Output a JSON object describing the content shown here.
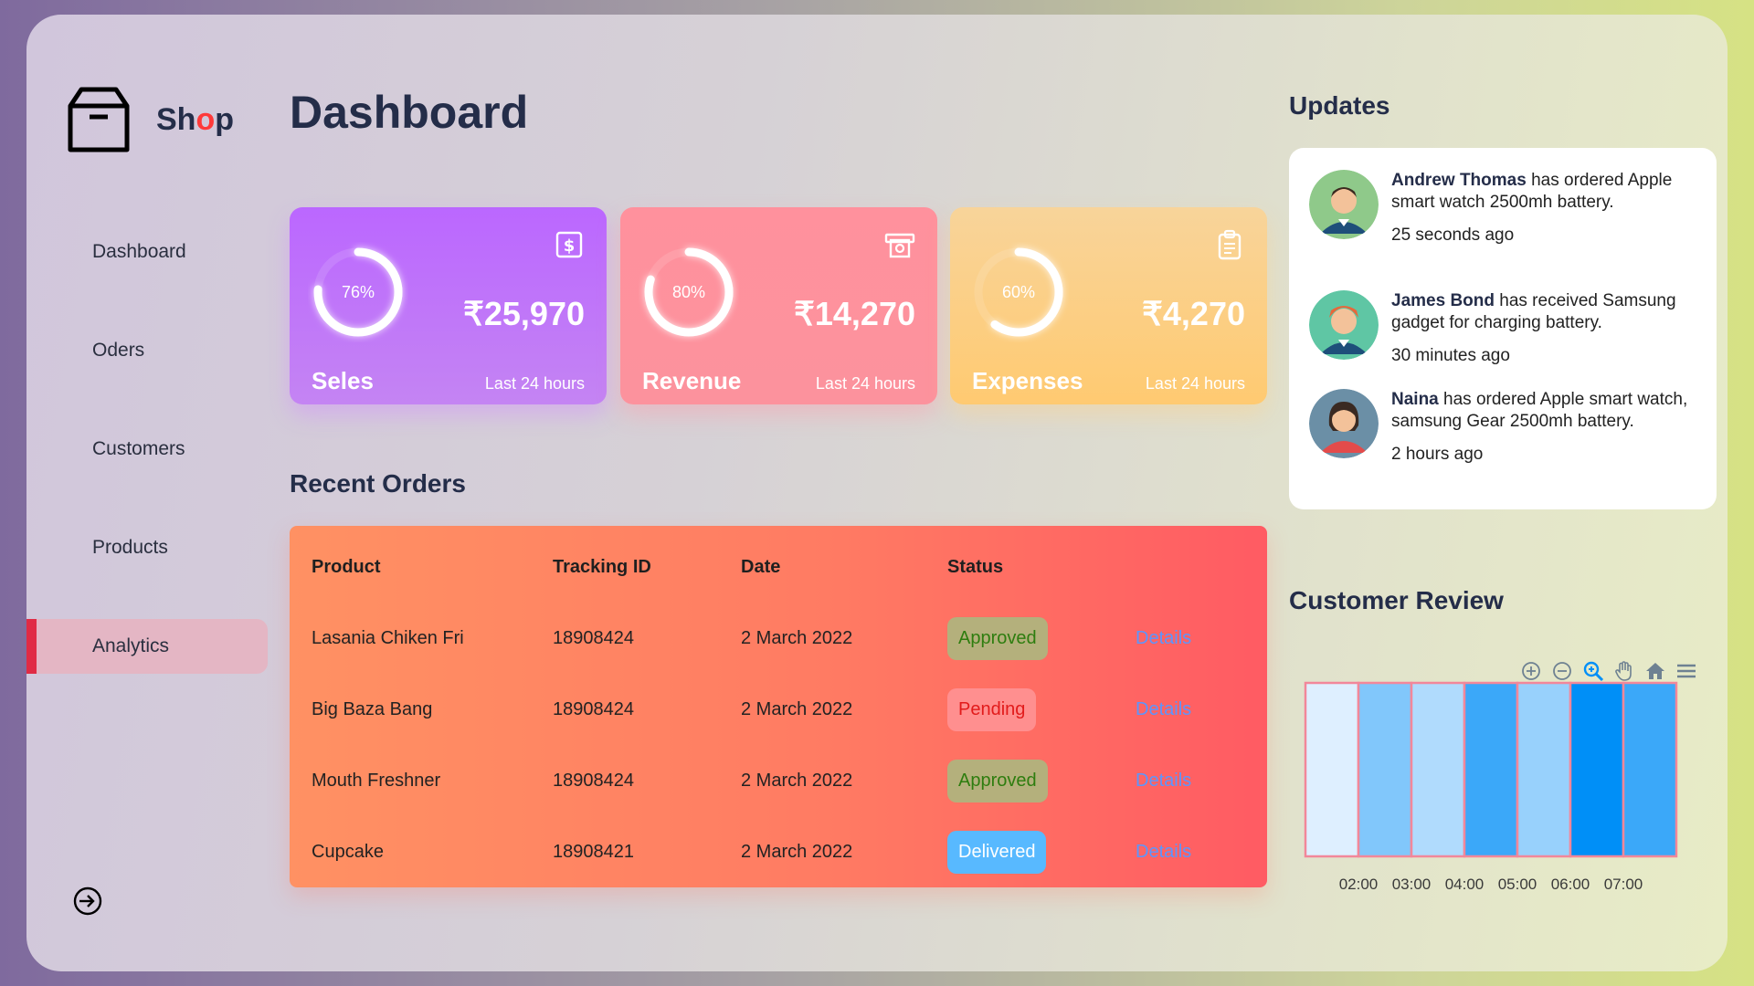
{
  "brand": {
    "prefix": "Sh",
    "accent": "o",
    "suffix": "p",
    "accent_color": "#ff3a3a"
  },
  "sidebar": {
    "items": [
      {
        "label": "Dashboard"
      },
      {
        "label": "Oders"
      },
      {
        "label": "Customers"
      },
      {
        "label": "Products"
      },
      {
        "label": "Analytics",
        "active": true
      }
    ],
    "signout_icon": "sign-out-icon"
  },
  "main": {
    "title": "Dashboard",
    "cards": [
      {
        "label": "Seles",
        "value": "₹25,970",
        "percent": "76%",
        "percent_value": 0.76,
        "sub": "Last 24 hours",
        "icon": "dollar-icon"
      },
      {
        "label": "Revenue",
        "value": "₹14,270",
        "percent": "80%",
        "percent_value": 0.8,
        "sub": "Last 24 hours",
        "icon": "money-icon"
      },
      {
        "label": "Expenses",
        "value": "₹4,270",
        "percent": "60%",
        "percent_value": 0.6,
        "sub": "Last 24 hours",
        "icon": "clipboard-icon"
      }
    ],
    "recent_orders": {
      "title": "Recent Orders",
      "columns": [
        "Product",
        "Tracking ID",
        "Date",
        "Status"
      ],
      "rows": [
        {
          "product": "Lasania Chiken Fri",
          "tracking": "18908424",
          "date": "2 March 2022",
          "status": "Approved",
          "action": "Details"
        },
        {
          "product": "Big Baza Bang",
          "tracking": "18908424",
          "date": "2 March 2022",
          "status": "Pending",
          "action": "Details"
        },
        {
          "product": "Mouth Freshner",
          "tracking": "18908424",
          "date": "2 March 2022",
          "status": "Approved",
          "action": "Details"
        },
        {
          "product": "Cupcake",
          "tracking": "18908421",
          "date": "2 March 2022",
          "status": "Delivered",
          "action": "Details"
        }
      ]
    }
  },
  "updates": {
    "title": "Updates",
    "items": [
      {
        "name": "Andrew Thomas",
        "text": " has ordered Apple smart watch 2500mh battery.",
        "time": "25 seconds ago"
      },
      {
        "name": "James Bond",
        "text": " has received Samsung gadget for charging battery.",
        "time": "30 minutes ago"
      },
      {
        "name": "Naina",
        "text": " has ordered Apple smart watch, samsung Gear 2500mh battery.",
        "time": "2 hours ago"
      }
    ]
  },
  "customer_review": {
    "title": "Customer Review",
    "toolbar_icons": [
      "zoom-in-icon",
      "zoom-out-icon",
      "magnify-icon",
      "pan-hand-icon",
      "home-icon",
      "menu-icon"
    ]
  },
  "chart_data": {
    "type": "heatmap",
    "title": "Customer Review",
    "tick_labels": [
      "02:00",
      "03:00",
      "04:00",
      "05:00",
      "06:00",
      "07:00"
    ],
    "cells": [
      {
        "intensity": 0.05
      },
      {
        "intensity": 0.45
      },
      {
        "intensity": 0.25
      },
      {
        "intensity": 0.75
      },
      {
        "intensity": 0.35
      },
      {
        "intensity": 1.0
      },
      {
        "intensity": 0.75
      }
    ],
    "colors": {
      "low": "#eaf4ff",
      "high": "#008ff7",
      "border": "#f2879a"
    }
  }
}
